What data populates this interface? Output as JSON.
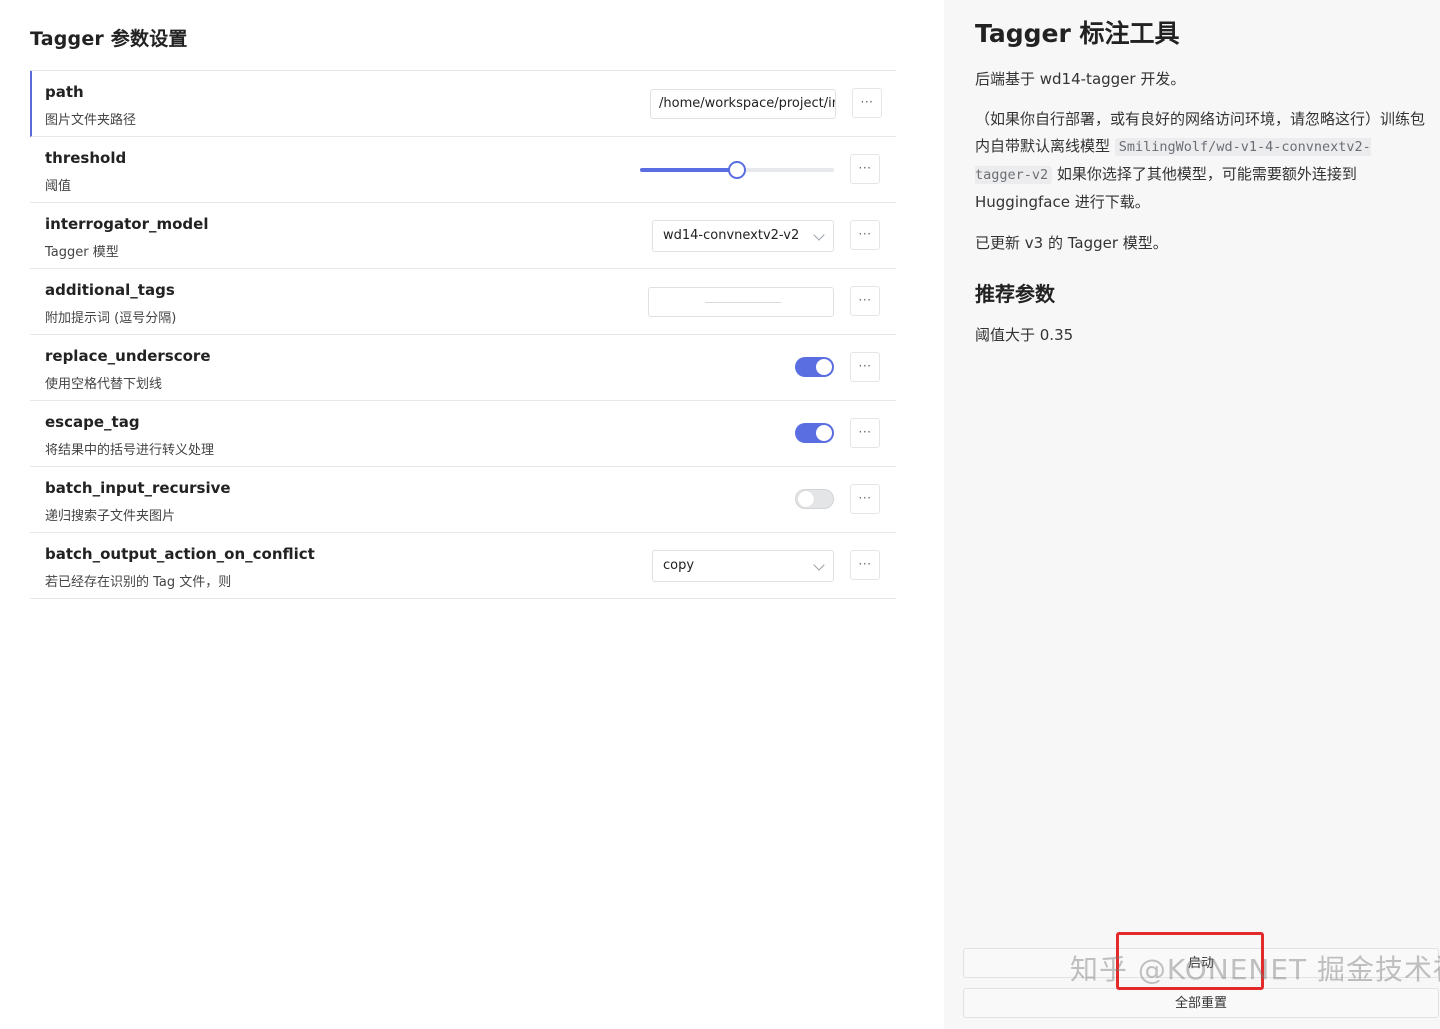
{
  "left_title": "Tagger 参数设置",
  "settings": [
    {
      "name": "path",
      "desc": "图片文件夹路径",
      "control": "text",
      "value": "/home/workspace/project/im"
    },
    {
      "name": "threshold",
      "desc": "阈值",
      "control": "slider",
      "level": 0.5
    },
    {
      "name": "interrogator_model",
      "desc": "Tagger 模型",
      "control": "select",
      "value": "wd14-convnextv2-v2"
    },
    {
      "name": "additional_tags",
      "desc": "附加提示词 (逗号分隔)",
      "control": "text",
      "value": ""
    },
    {
      "name": "replace_underscore",
      "desc": "使用空格代替下划线",
      "control": "toggle",
      "on": true
    },
    {
      "name": "escape_tag",
      "desc": "将结果中的括号进行转义处理",
      "control": "toggle",
      "on": true
    },
    {
      "name": "batch_input_recursive",
      "desc": "递归搜索子文件夹图片",
      "control": "toggle",
      "on": false
    },
    {
      "name": "batch_output_action_on_conflict",
      "desc": "若已经存在识别的 Tag 文件，则",
      "control": "select",
      "value": "copy"
    }
  ],
  "more_label": "···",
  "doc": {
    "title": "Tagger 标注工具",
    "p1": "后端基于 wd14-tagger 开发。",
    "p2_before": "（如果你自行部署，或有良好的网络访问环境，请忽略这行）训练包内自带默认离线模型 ",
    "p2_code": "SmilingWolf/wd-v1-4-convnextv2-tagger-v2",
    "p2_after": " 如果你选择了其他模型，可能需要额外连接到 Huggingface 进行下载。",
    "p3": "已更新 v3 的 Tagger 模型。",
    "h2": "推荐参数",
    "p4": "阈值大于 0.35"
  },
  "buttons": {
    "start": "启动",
    "reset": "全部重置"
  },
  "watermark": "知乎 @KONENET 掘金技术社区 @ KONENET",
  "colors": {
    "accent": "#5b6ee1",
    "highlight": "#e22a2a"
  }
}
